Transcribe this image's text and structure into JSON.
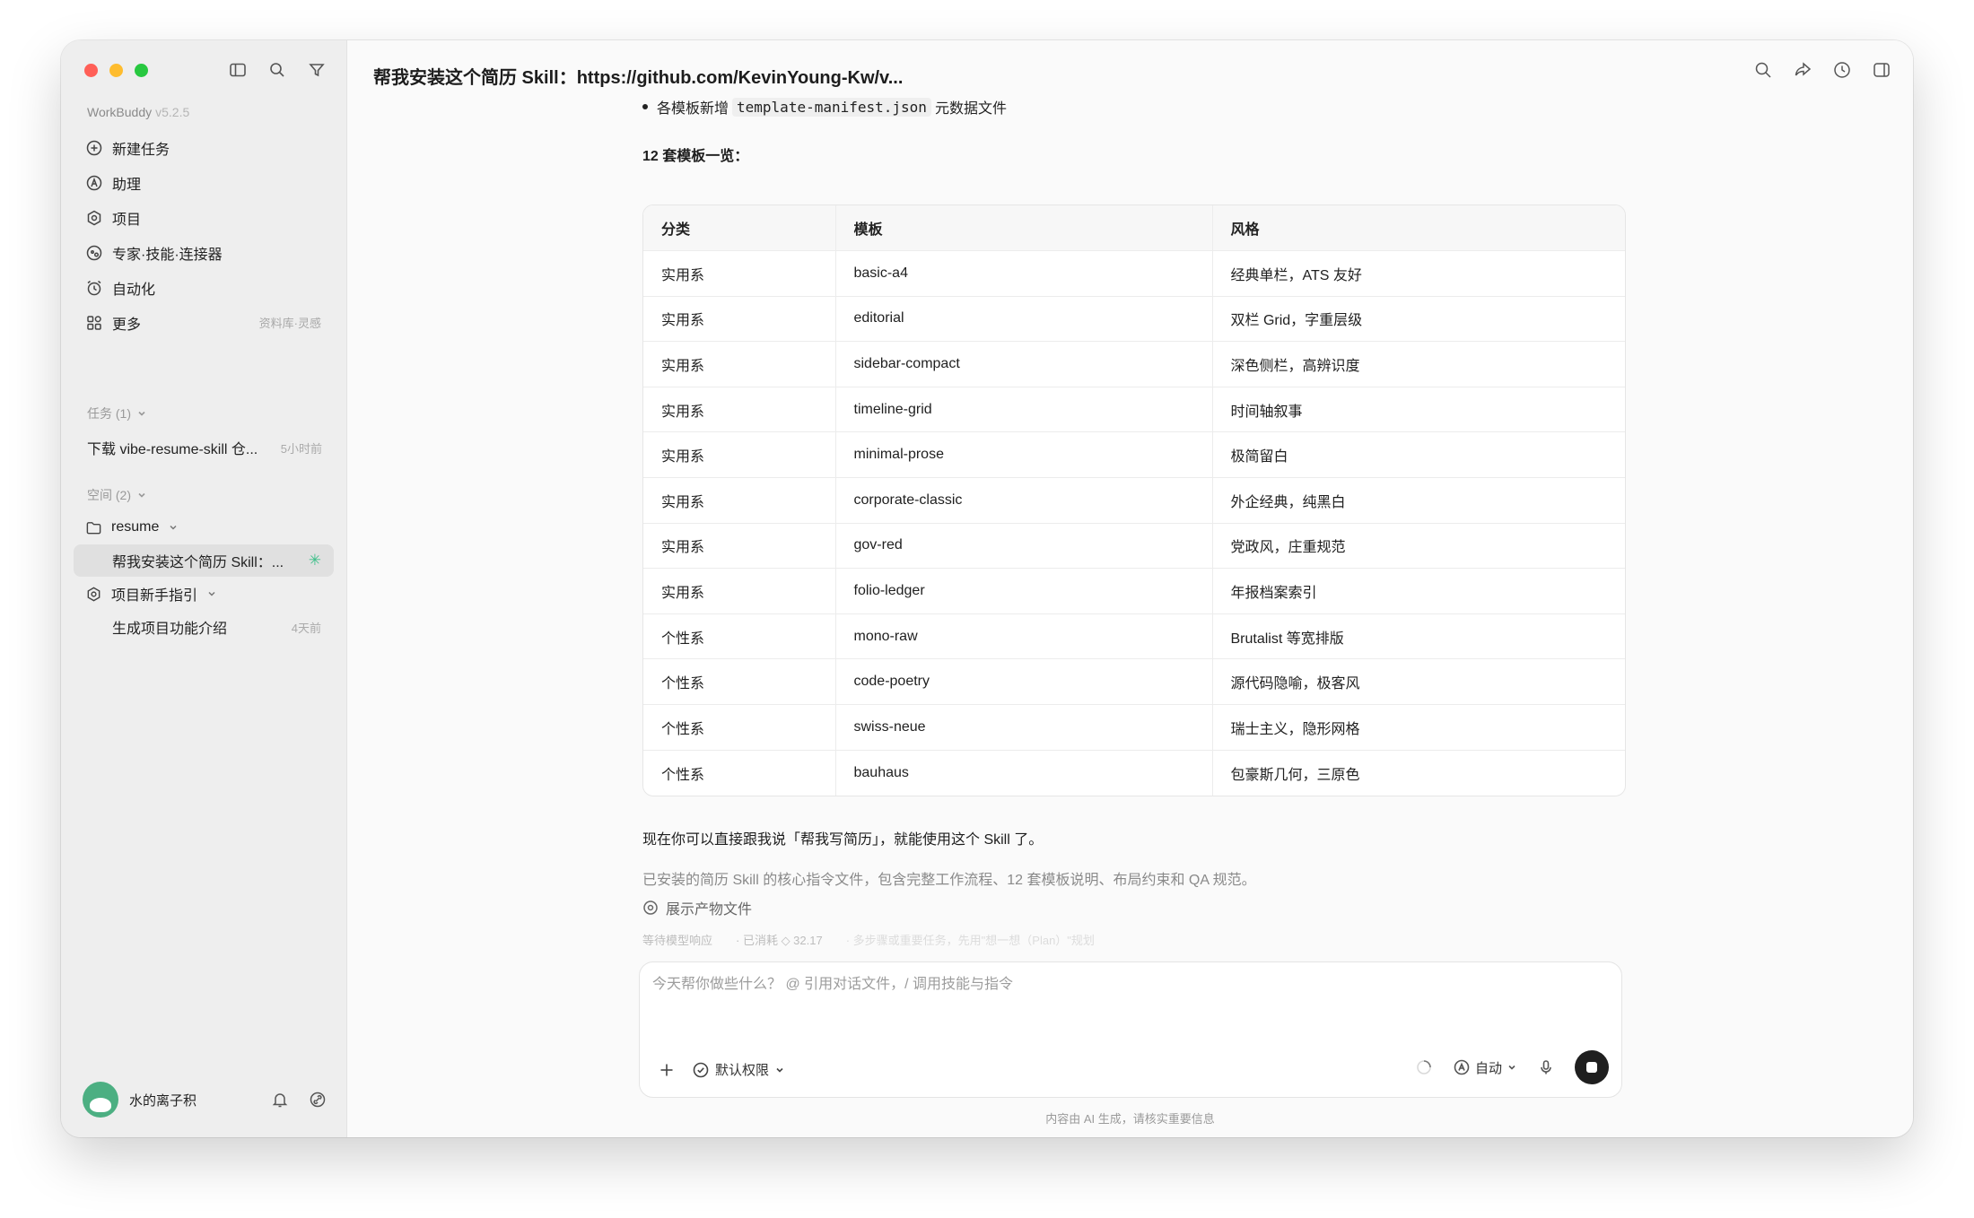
{
  "sidebar": {
    "app_name": "WorkBuddy",
    "app_version": "v5.2.5",
    "nav": [
      {
        "label": "新建任务"
      },
      {
        "label": "助理"
      },
      {
        "label": "项目"
      },
      {
        "label": "专家·技能·连接器"
      },
      {
        "label": "自动化"
      },
      {
        "label": "更多",
        "hint": "资料库·灵感"
      }
    ],
    "tasks_header": "任务 (1)",
    "tasks": [
      {
        "label": "下载 vibe-resume-skill 仓...",
        "time": "5小时前"
      }
    ],
    "spaces_header": "空间 (2)",
    "spaces": {
      "resume": "resume",
      "resume_active_item": "帮我安装这个简历 Skill：...",
      "guide": "项目新手指引",
      "guide_item": "生成项目功能介绍",
      "guide_item_time": "4天前"
    },
    "user_name": "水的离子积"
  },
  "main": {
    "title": "帮我安装这个简历 Skill：https://github.com/KevinYoung-Kw/v...",
    "bullet_prefix": "各模板新增",
    "bullet_code": "template-manifest.json",
    "bullet_suffix": "元数据文件",
    "heading": "12 套模板一览：",
    "table": {
      "headers": [
        "分类",
        "模板",
        "风格"
      ],
      "rows": [
        [
          "实用系",
          "basic-a4",
          "经典单栏，ATS 友好"
        ],
        [
          "实用系",
          "editorial",
          "双栏 Grid，字重层级"
        ],
        [
          "实用系",
          "sidebar-compact",
          "深色侧栏，高辨识度"
        ],
        [
          "实用系",
          "timeline-grid",
          "时间轴叙事"
        ],
        [
          "实用系",
          "minimal-prose",
          "极简留白"
        ],
        [
          "实用系",
          "corporate-classic",
          "外企经典，纯黑白"
        ],
        [
          "实用系",
          "gov-red",
          "党政风，庄重规范"
        ],
        [
          "实用系",
          "folio-ledger",
          "年报档案索引"
        ],
        [
          "个性系",
          "mono-raw",
          "Brutalist 等宽排版"
        ],
        [
          "个性系",
          "code-poetry",
          "源代码隐喻，极客风"
        ],
        [
          "个性系",
          "swiss-neue",
          "瑞士主义，隐形网格"
        ],
        [
          "个性系",
          "bauhaus",
          "包豪斯几何，三原色"
        ]
      ]
    },
    "closing": "现在你可以直接跟我说「帮我写简历」，就能使用这个 Skill 了。",
    "summary": "已安装的简历 Skill 的核心指令文件，包含完整工作流程、12 套模板说明、布局约束和 QA 规范。",
    "show_files": "展示产物文件",
    "status": {
      "waiting": "等待模型响应",
      "consumed": "· 已消耗 ◇ 32.17",
      "tip": "· 多步骤或重要任务，先用\"想一想（Plan）\"规划"
    },
    "composer": {
      "placeholder": "今天帮你做些什么？ @ 引用对话文件，/ 调用技能与指令",
      "permission": "默认权限",
      "mode": "自动"
    },
    "footer": "内容由 AI 生成，请核实重要信息"
  }
}
